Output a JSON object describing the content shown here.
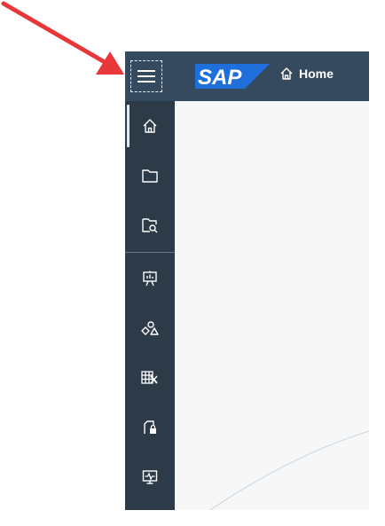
{
  "header": {
    "logo_text": "SAP",
    "breadcrumb_label": "Home",
    "menu_icon": "hamburger-menu-icon"
  },
  "sidenav": {
    "items": [
      {
        "icon": "home-icon",
        "selected": true
      },
      {
        "icon": "folder-icon",
        "selected": false
      },
      {
        "icon": "folder-search-icon",
        "selected": false
      },
      {
        "icon": "presentation-icon",
        "selected": false
      },
      {
        "icon": "shapes-icon",
        "selected": false
      },
      {
        "icon": "table-edit-icon",
        "selected": false
      },
      {
        "icon": "document-lock-icon",
        "selected": false
      },
      {
        "icon": "monitor-pulse-icon",
        "selected": false
      }
    ]
  },
  "annotation": {
    "type": "arrow",
    "color": "#e8363b"
  },
  "colors": {
    "header_bg": "#354a5f",
    "sidenav_bg": "#2d3a48",
    "content_bg": "#f7f7f7",
    "logo_blue": "#1e6fd9"
  }
}
